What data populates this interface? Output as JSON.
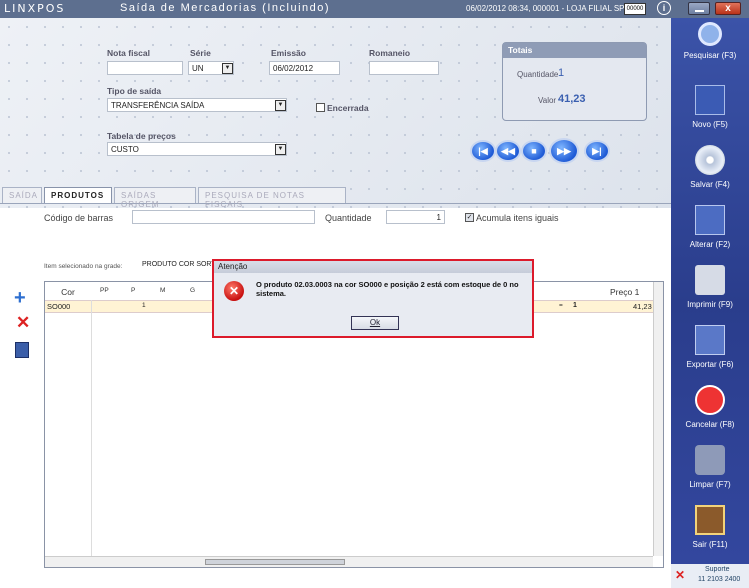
{
  "window": {
    "app_logo": "LINXPOS",
    "title": "Saída de Mercadorias (Incluindo)",
    "meta": "06/02/2012 08:34, 000001 - LOJA FILIAL SP.",
    "keyboard_badge": "00000",
    "info_label": "i",
    "close_label": "x"
  },
  "form": {
    "nota_fiscal_label": "Nota fiscal",
    "nota_fiscal_value": "",
    "serie_label": "Série",
    "serie_value": "UN",
    "emissao_label": "Emissão",
    "emissao_value": "06/02/2012",
    "romaneio_label": "Romaneio",
    "romaneio_value": "",
    "tipo_saida_label": "Tipo de saída",
    "tipo_saida_value": "TRANSFERÊNCIA SAÍDA",
    "encerrada_label": "Encerrada",
    "tabela_precos_label": "Tabela de preços",
    "tabela_precos_value": "CUSTO"
  },
  "totais": {
    "title": "Totais",
    "quantidade_label": "Quantidade",
    "quantidade_value": "1",
    "valor_label": "Valor",
    "valor_value": "41,23"
  },
  "nav_buttons": [
    {
      "name": "first",
      "glyph": "|◀"
    },
    {
      "name": "prev",
      "glyph": "◀◀"
    },
    {
      "name": "stop",
      "glyph": "■"
    },
    {
      "name": "next",
      "glyph": "▶▶"
    },
    {
      "name": "last",
      "glyph": "▶|"
    }
  ],
  "tabs": [
    {
      "label": "SAÍDA",
      "active": false
    },
    {
      "label": "PRODUTOS",
      "active": true
    },
    {
      "label": "SAÍDAS ORIGEM",
      "active": false
    },
    {
      "label": "PESQUISA DE NOTAS FISCAIS",
      "active": false
    }
  ],
  "produtos": {
    "codigo_barras_label": "Código de barras",
    "codigo_barras_value": "",
    "quantidade_label": "Quantidade",
    "quantidade_value": "1",
    "acumula_label": "Acumula itens iguais",
    "item_selecionado_label": "Item selecionado na grade:",
    "item_selecionado_value": "PRODUTO COR SORTIDA"
  },
  "grid": {
    "headers": {
      "cor": "Cor",
      "pp": "PP",
      "p": "P",
      "m": "M",
      "g": "G",
      "preco": "Preço 1"
    },
    "row": {
      "cor": "SO000",
      "p": "1",
      "qty_prefix": "=",
      "qty": "1",
      "preco": "41,23"
    }
  },
  "dialog": {
    "title": "Atenção",
    "message": "O produto 02.03.0003 na cor SO000 e posição 2 está com estoque de 0 no sistema.",
    "ok_label": "Ok"
  },
  "sidebar": [
    {
      "label": "Pesquisar (F3)",
      "icon": "magnifier-icon"
    },
    {
      "label": "Novo (F5)",
      "icon": "new-document-icon"
    },
    {
      "label": "Salvar (F4)",
      "icon": "disc-icon"
    },
    {
      "label": "Alterar (F2)",
      "icon": "pen-icon"
    },
    {
      "label": "Imprimir (F9)",
      "icon": "printer-icon"
    },
    {
      "label": "Exportar (F6)",
      "icon": "export-icon"
    },
    {
      "label": "Cancelar (F8)",
      "icon": "cancel-icon"
    },
    {
      "label": "Limpar (F7)",
      "icon": "broom-icon"
    },
    {
      "label": "Sair (F11)",
      "icon": "exit-door-icon"
    }
  ],
  "support": {
    "label": "Suporte",
    "phone": "11 2103 2400"
  },
  "colors": {
    "titlebar": "#5d6f8f",
    "sidebar": "#2a3d8c",
    "dialog_border": "#dc1a2b",
    "row_highlight": "#fff3d4"
  }
}
